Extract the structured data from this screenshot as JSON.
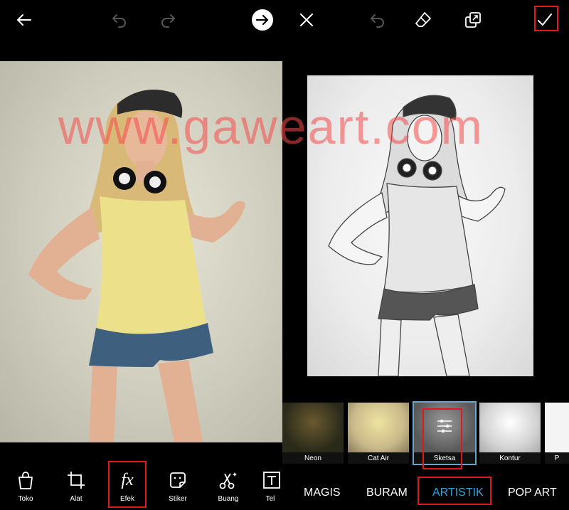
{
  "left_panel": {
    "toolbar": {
      "back_icon": "arrow-left-icon",
      "undo_icon": "undo-icon",
      "redo_icon": "redo-icon",
      "next_icon": "arrow-right-circle-icon"
    },
    "tools": [
      {
        "label": "Toko",
        "icon": "shopping-bag-icon"
      },
      {
        "label": "Alat",
        "icon": "crop-icon"
      },
      {
        "label": "Efek",
        "icon": "fx-icon"
      },
      {
        "label": "Stiker",
        "icon": "sticker-icon"
      },
      {
        "label": "Buang",
        "icon": "cutout-icon"
      },
      {
        "label": "Tel",
        "icon": "text-icon"
      }
    ],
    "fx_glyph": "fx"
  },
  "right_panel": {
    "toolbar": {
      "close_icon": "close-icon",
      "undo_icon": "undo-icon",
      "eraser_icon": "eraser-icon",
      "compare_icon": "compare-icon",
      "apply_icon": "checkmark-icon"
    },
    "effects": [
      {
        "label": "Neon",
        "selected": false
      },
      {
        "label": "Cat Air",
        "selected": false
      },
      {
        "label": "Sketsa",
        "selected": true
      },
      {
        "label": "Kontur",
        "selected": false
      },
      {
        "label": "P",
        "selected": false
      }
    ],
    "categories": [
      {
        "label": "MAGIS",
        "active": false
      },
      {
        "label": "BURAM",
        "active": false
      },
      {
        "label": "ARTISTIK",
        "active": true
      },
      {
        "label": "POP ART",
        "active": false
      }
    ]
  },
  "watermark": "www.gaweart.com",
  "colors": {
    "highlight": "#e0181d",
    "accent_blue": "#28a8e0",
    "selected_border": "#6aa6c6"
  }
}
